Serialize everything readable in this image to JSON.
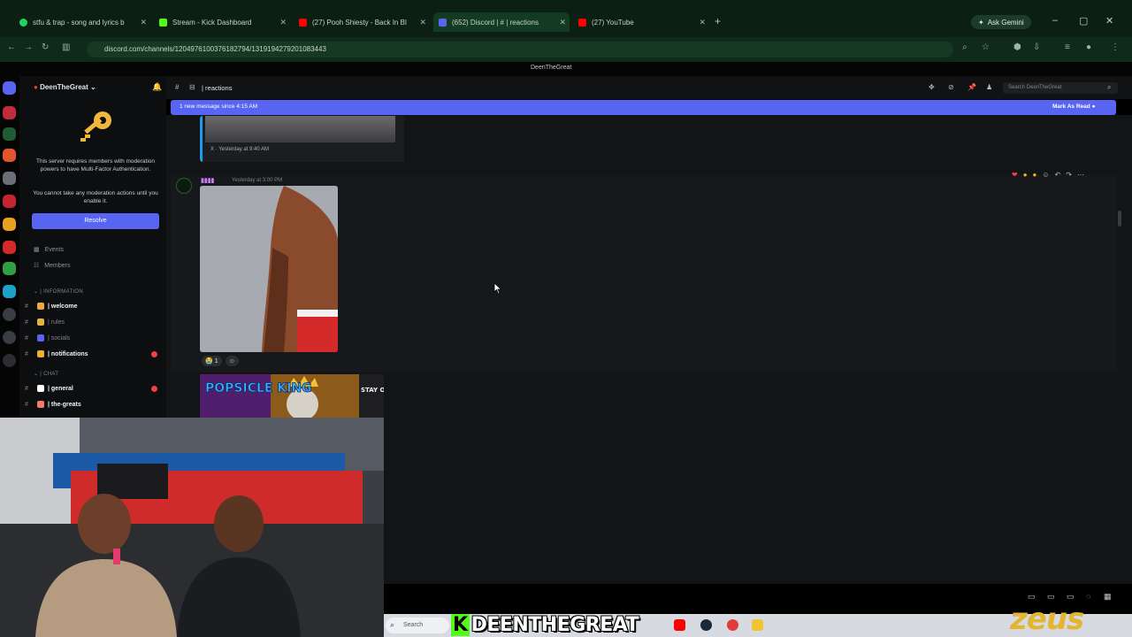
{
  "browser": {
    "tabs": [
      {
        "label": "stfu & trap - song and lyrics b",
        "color": "#1ed760",
        "active": false
      },
      {
        "label": "Stream - Kick Dashboard",
        "color": "#53fc18",
        "active": false
      },
      {
        "label": "(27) Pooh Shiesty - Back In Bl",
        "color": "#ff0000",
        "active": false
      },
      {
        "label": "(652) Discord | # | reactions",
        "color": "#5865f2",
        "active": true
      },
      {
        "label": "(27) YouTube",
        "color": "#ff0000",
        "active": false
      }
    ],
    "new_tab": "+",
    "gemini": "Ask Gemini",
    "url": "discord.com/channels/1204976100376182794/1319194279201083443"
  },
  "discord": {
    "window_title": "DeenTheGreat",
    "server_name": "DeenTheGreat",
    "mfa_notice": "This server requires members with moderation powers to have Multi-Factor Authentication.",
    "mfa_notice2": "You cannot take any moderation actions until you enable it.",
    "resolve_label": "Resolve",
    "nav": [
      {
        "label": "Events"
      },
      {
        "label": "Members"
      }
    ],
    "categories": {
      "information": "| INFORMATION",
      "chat": "| CHAT"
    },
    "channels": [
      {
        "name": "| welcome",
        "unread": true,
        "color": "#f2a93b",
        "badge": false
      },
      {
        "name": "| rules",
        "unread": false,
        "color": "#e3b341",
        "badge": false
      },
      {
        "name": "| socials",
        "unread": false,
        "color": "#5865f2",
        "badge": false
      },
      {
        "name": "| notifications",
        "unread": true,
        "color": "#f0b132",
        "badge": true
      },
      {
        "name": "| general",
        "unread": true,
        "color": "#ffffff",
        "badge": true
      },
      {
        "name": "| the-greats",
        "unread": true,
        "color": "#f47b67",
        "badge": false
      }
    ],
    "channel_header": "| reactions",
    "search_placeholder": "Search DeenTheGreat",
    "banner_text": "1 new message since 4:15 AM",
    "mark_read": "Mark As Read",
    "embed_meta": "X · Yesterday at 9:40 AM",
    "message_timestamp": "Yesterday at 3:00 PM",
    "reactions": [
      {
        "emoji": "😭",
        "count": "1"
      },
      {
        "emoji": "☺",
        "count": ""
      }
    ],
    "poster_text_left": "POPSICLE KING",
    "poster_text_right": "STAY OR EAT"
  },
  "overlay": {
    "kick_letter": "K",
    "kick_name": "DEENTHEGREAT",
    "sponsor": "zeus",
    "taskbar_search": "Search"
  },
  "colors": {
    "discord_blurple": "#5865f2",
    "kick_green": "#53fc18",
    "zeus_gold": "#e2b631"
  }
}
